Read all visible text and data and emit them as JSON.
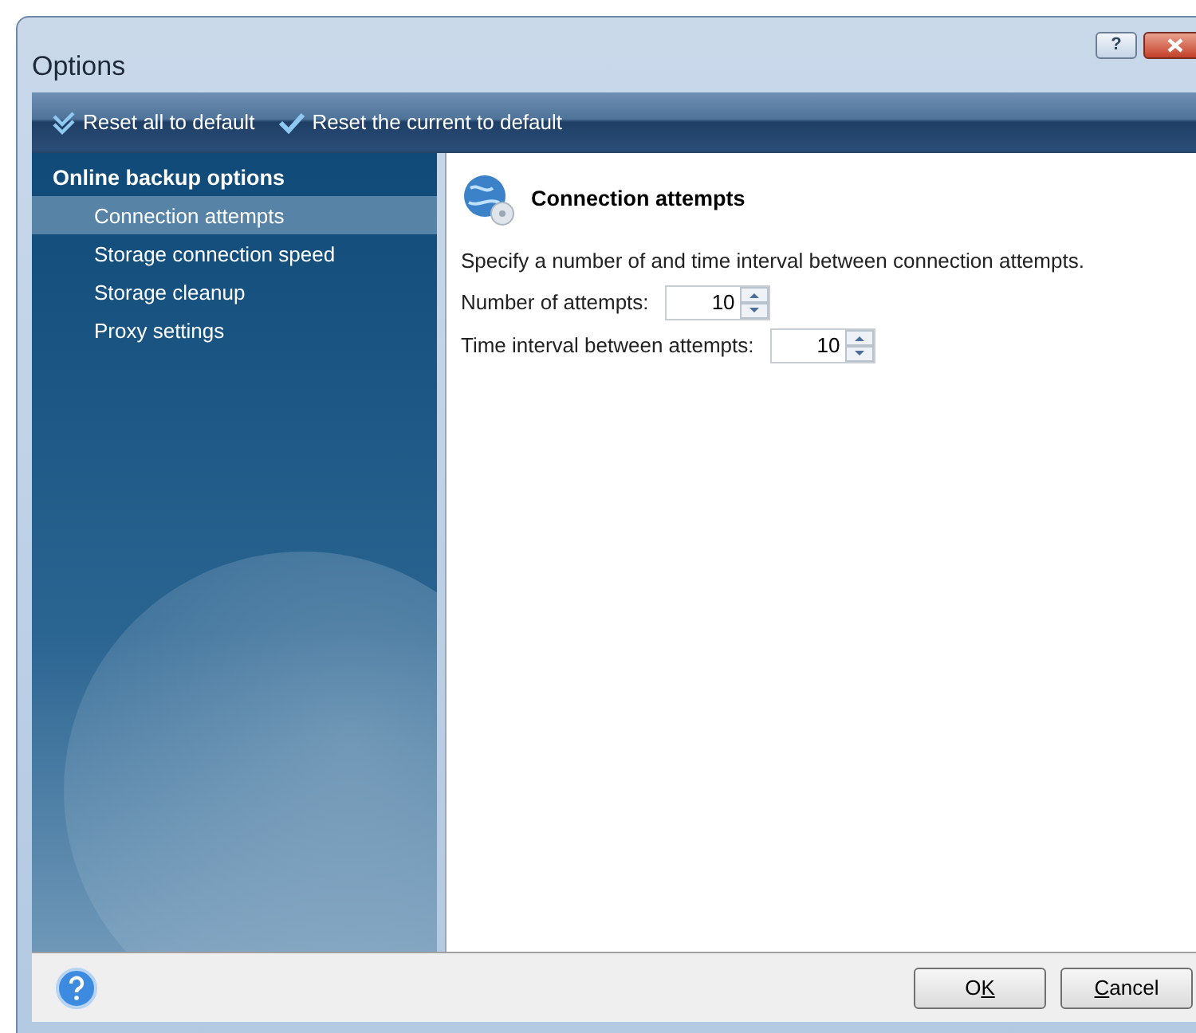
{
  "window": {
    "title": "Options",
    "help_button": "?"
  },
  "toolbar": [
    {
      "label": "Reset all to default",
      "kind": "all"
    },
    {
      "label": "Reset the current to default",
      "kind": "current"
    }
  ],
  "sidebar": {
    "group": "Online backup options",
    "items": [
      {
        "label": "Connection attempts",
        "selected": true
      },
      {
        "label": "Storage connection speed",
        "selected": false
      },
      {
        "label": "Storage cleanup",
        "selected": false
      },
      {
        "label": "Proxy settings",
        "selected": false
      }
    ]
  },
  "content": {
    "title": "Connection attempts",
    "description": "Specify a number of and time interval between connection attempts.",
    "fields": [
      {
        "label": "Number of attempts:",
        "value": "10"
      },
      {
        "label": "Time interval between attempts:",
        "value": "10"
      }
    ]
  },
  "footer": {
    "buttons": [
      {
        "before": "O",
        "access_key": "K"
      },
      {
        "access_key": "C",
        "after": "ancel"
      }
    ]
  }
}
